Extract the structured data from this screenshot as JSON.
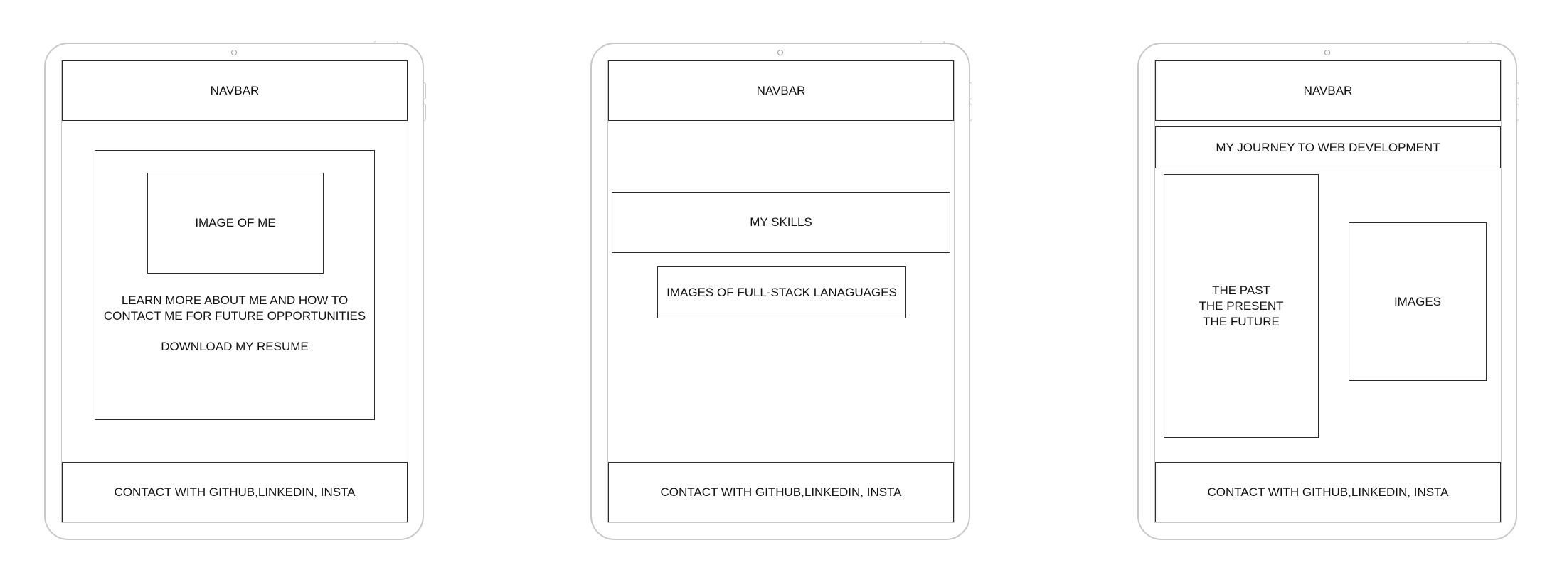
{
  "tablets": [
    {
      "navbar": "NAVBAR",
      "image_box": "IMAGE OF ME",
      "about_line1": "LEARN MORE ABOUT ME AND HOW TO",
      "about_line2": "CONTACT ME FOR FUTURE OPPORTUNITIES",
      "resume": "DOWNLOAD MY RESUME",
      "footer": "CONTACT WITH GITHUB,LINKEDIN, INSTA"
    },
    {
      "navbar": "NAVBAR",
      "skills": "MY SKILLS",
      "languages": "IMAGES OF FULL-STACK LANAGUAGES",
      "footer": "CONTACT WITH GITHUB,LINKEDIN, INSTA"
    },
    {
      "navbar": "NAVBAR",
      "journey": "MY JOURNEY TO WEB DEVELOPMENT",
      "timeline": "THE PAST\nTHE PRESENT\nTHE FUTURE",
      "images": "IMAGES",
      "footer": "CONTACT WITH GITHUB,LINKEDIN, INSTA"
    }
  ],
  "colors": {
    "frame": "#c8c8c8",
    "box_border": "#2a2a2a",
    "text": "#111111",
    "background": "#ffffff"
  }
}
